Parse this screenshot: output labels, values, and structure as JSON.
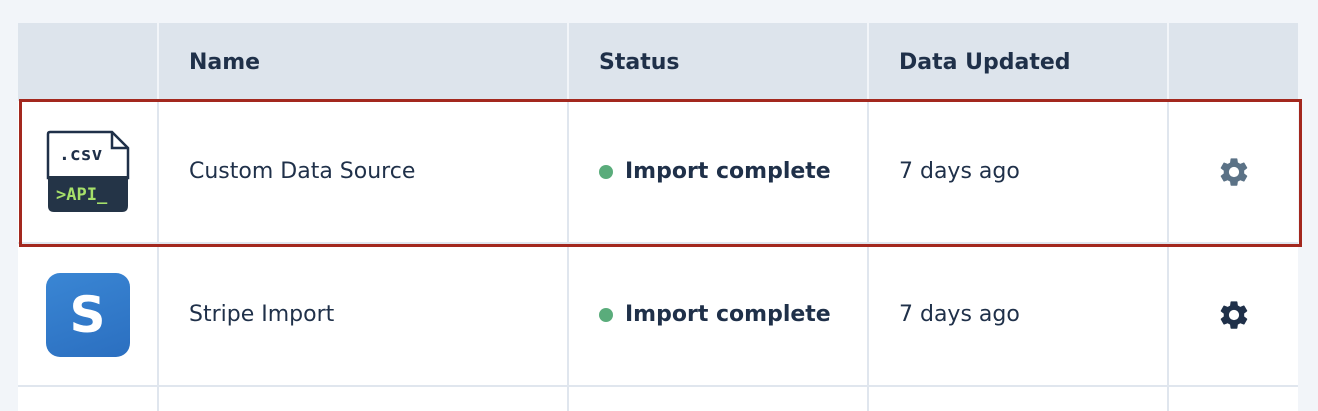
{
  "table": {
    "headers": {
      "icon": "",
      "name": "Name",
      "status": "Status",
      "updated": "Data Updated",
      "actions": ""
    },
    "rows": [
      {
        "icon": "csv-api-icon",
        "icon_text_top": ".csv",
        "icon_text_bottom": ">API_",
        "name": "Custom Data Source",
        "status": "Import complete",
        "updated": "7 days ago",
        "selected": true
      },
      {
        "icon": "stripe-icon",
        "icon_letter": "S",
        "name": "Stripe Import",
        "status": "Import complete",
        "updated": "7 days ago",
        "selected": false
      }
    ]
  },
  "colors": {
    "status_ok": "#5aac7b",
    "highlight": "#a3281e",
    "gear_muted": "#5b7286",
    "gear_dark": "#1f3049"
  }
}
